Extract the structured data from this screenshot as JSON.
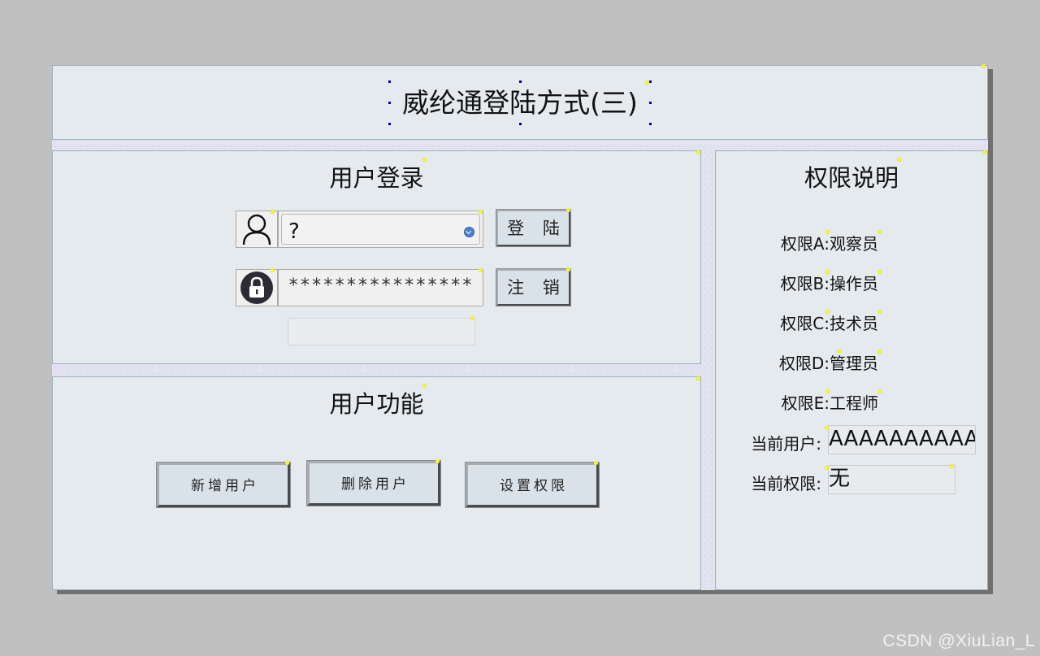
{
  "title": "威纶通登陆方式(三)",
  "login_panel": {
    "heading": "用户登录",
    "username_value": "?",
    "password_value": "****************",
    "login_button": "登 陆",
    "logout_button": "注 销",
    "message": ""
  },
  "function_panel": {
    "heading": "用户功能",
    "buttons": [
      "新增用户",
      "删除用户",
      "设置权限"
    ]
  },
  "permission_panel": {
    "heading": "权限说明",
    "levels": [
      {
        "label": "权限A:",
        "role": "观察员"
      },
      {
        "label": "权限B:",
        "role": "操作员"
      },
      {
        "label": "权限C:",
        "role": "技术员"
      },
      {
        "label": "权限D:",
        "role": "管理员"
      },
      {
        "label": "权限E:",
        "role": "工程师"
      }
    ],
    "current_user_label": "当前用户:",
    "current_user_value": "AAAAAAAAAA",
    "current_permission_label": "当前权限:",
    "current_permission_value": "无"
  },
  "watermark": "CSDN @XiuLian_L",
  "icons": {
    "user": "user-icon",
    "lock": "lock-icon",
    "dropdown": "dropdown-arrow-icon"
  },
  "colors": {
    "background": "#c0c0c0",
    "panel": "#e5eaee",
    "button_face": "#d9e2e8",
    "marker": "#f4f43a"
  }
}
